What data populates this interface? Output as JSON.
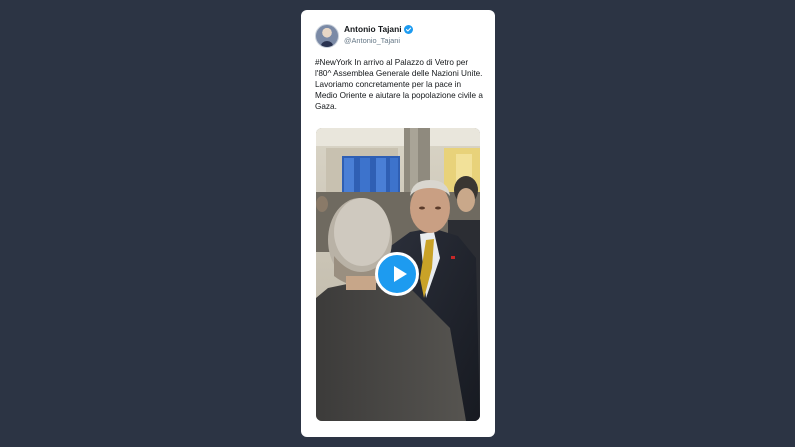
{
  "tweet": {
    "author": {
      "display_name": "Antonio Tajani",
      "handle": "@Antonio_Tajani",
      "verified": true,
      "avatar_icon": "avatar-photo"
    },
    "text": "#NewYork In arrivo al Palazzo di Vetro per l'80^ Assemblea Generale delle Nazioni Unite. Lavoriamo concretamente per la pace in Medio Oriente e aiutare la popolazione civile a Gaza.",
    "media": {
      "type": "video",
      "play_icon": "play-icon"
    }
  },
  "colors": {
    "background": "#2c3444",
    "card": "#ffffff",
    "accent": "#1d9bf0",
    "text_primary": "#14171a",
    "text_secondary": "#657786"
  }
}
